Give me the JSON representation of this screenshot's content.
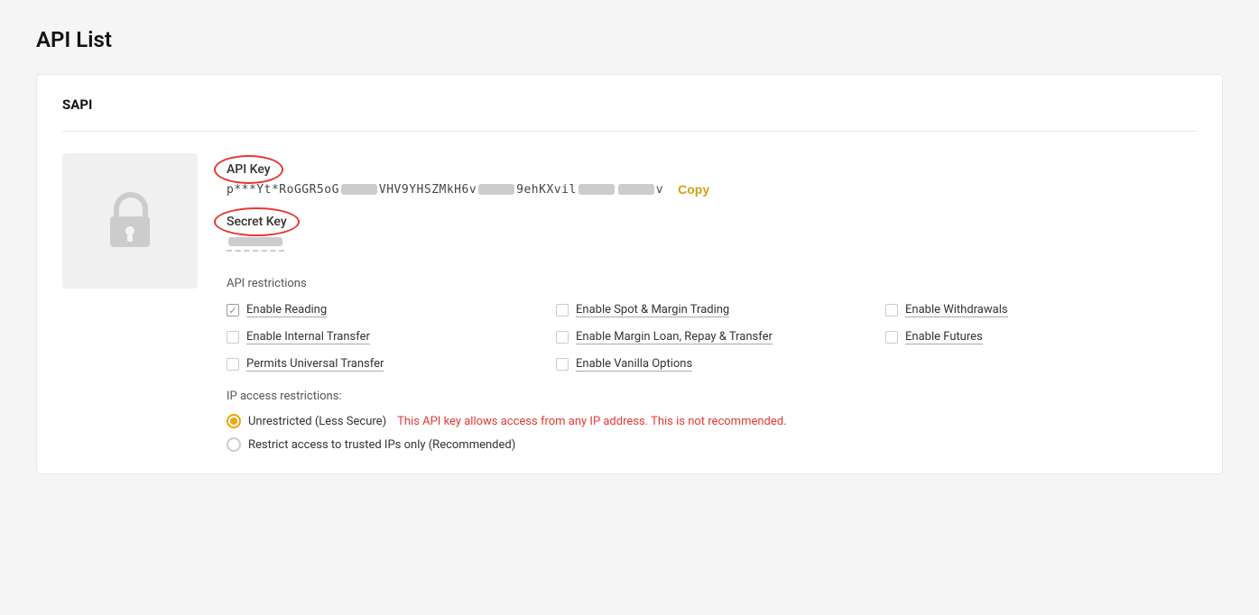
{
  "page": {
    "title": "API List"
  },
  "section": {
    "label": "SAPI"
  },
  "api_key": {
    "label": "API Key",
    "value_prefix": "p***Yt*RoGGR5oG",
    "value_middle1": "VHV9YHSZMkH6v",
    "value_middle2": "9ehKXvil",
    "value_middle3": "",
    "value_suffix": "v",
    "copy_label": "Copy"
  },
  "secret_key": {
    "label": "Secret Key",
    "masked_value": "••••••••"
  },
  "restrictions": {
    "section_label": "API restrictions",
    "items": [
      {
        "id": "enable-reading",
        "label": "Enable Reading",
        "checked": true,
        "col": 1
      },
      {
        "id": "enable-spot-margin",
        "label": "Enable Spot & Margin Trading",
        "checked": false,
        "col": 2
      },
      {
        "id": "enable-withdrawals",
        "label": "Enable Withdrawals",
        "checked": false,
        "col": 3
      },
      {
        "id": "enable-internal-transfer",
        "label": "Enable Internal Transfer",
        "checked": false,
        "col": 1
      },
      {
        "id": "enable-margin-loan",
        "label": "Enable Margin Loan, Repay & Transfer",
        "checked": false,
        "col": 2
      },
      {
        "id": "enable-futures",
        "label": "Enable Futures",
        "checked": false,
        "col": 3
      },
      {
        "id": "permits-universal-transfer",
        "label": "Permits Universal Transfer",
        "checked": false,
        "col": 1
      },
      {
        "id": "enable-vanilla-options",
        "label": "Enable Vanilla Options",
        "checked": false,
        "col": 2
      }
    ]
  },
  "ip_access": {
    "label": "IP access restrictions:",
    "options": [
      {
        "id": "unrestricted",
        "label": "Unrestricted (Less Secure)",
        "warning": "This API key allows access from any IP address. This is not recommended.",
        "selected": true
      },
      {
        "id": "restrict-trusted",
        "label": "Restrict access to trusted IPs only (Recommended)",
        "selected": false
      }
    ]
  }
}
